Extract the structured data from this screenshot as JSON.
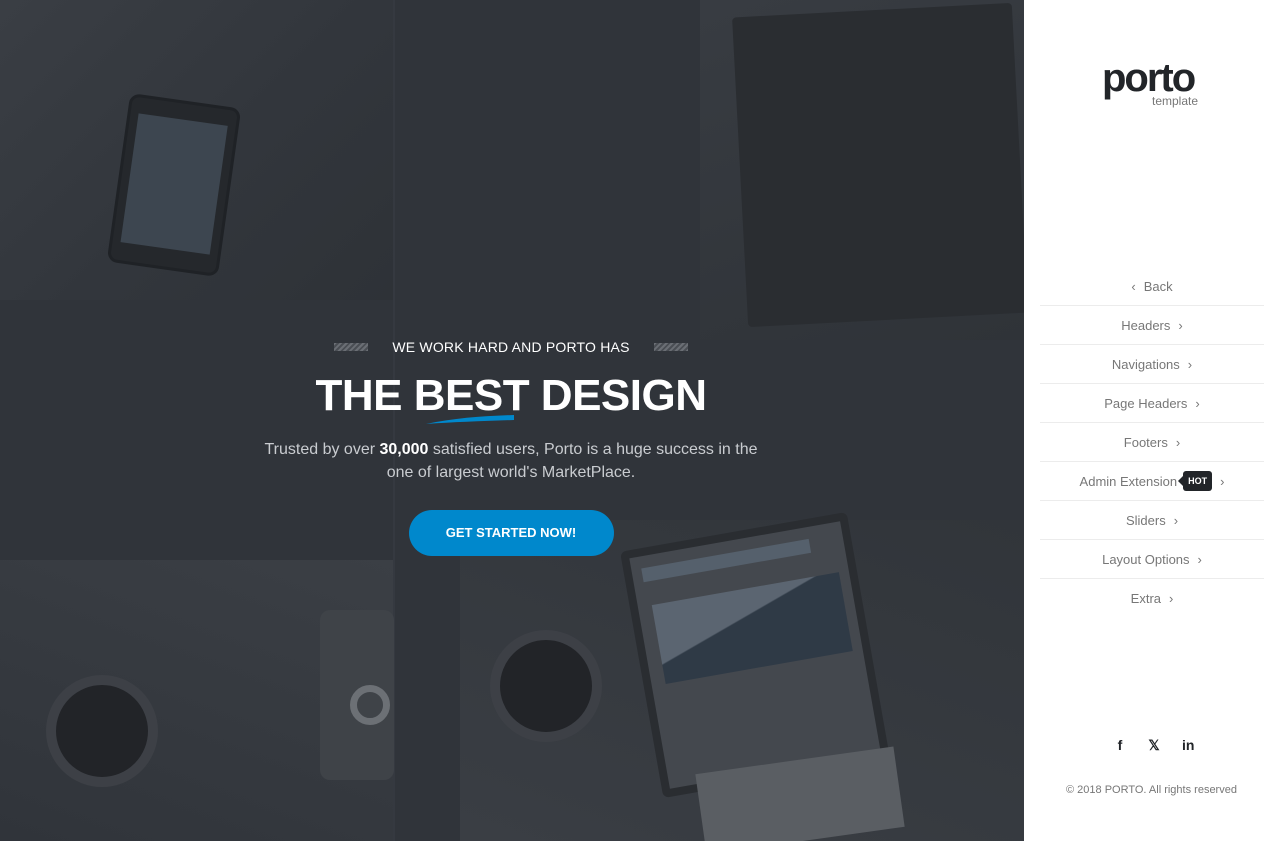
{
  "hero": {
    "eyebrow": "WE WORK HARD AND PORTO HAS",
    "headline_pre": "THE ",
    "headline_highlight": "BEST",
    "headline_post": " DESIGN",
    "lead_pre": "Trusted by over ",
    "lead_strong": "30,000",
    "lead_post": " satisfied users, Porto is a huge success in the one of largest world's MarketPlace.",
    "cta_label": "GET STARTED NOW!",
    "accent_color": "#0088cc"
  },
  "sidebar": {
    "logo_text": "porto",
    "logo_sub": "template",
    "back_label": "Back",
    "items": [
      {
        "label": "Headers"
      },
      {
        "label": "Navigations"
      },
      {
        "label": "Page Headers"
      },
      {
        "label": "Footers"
      },
      {
        "label": "Admin Extension",
        "badge": "HOT"
      },
      {
        "label": "Sliders"
      },
      {
        "label": "Layout Options"
      },
      {
        "label": "Extra"
      }
    ],
    "social": {
      "facebook": "f",
      "twitter": "𝕏",
      "linkedin": "in"
    },
    "copyright": "© 2018 PORTO. All rights reserved"
  }
}
